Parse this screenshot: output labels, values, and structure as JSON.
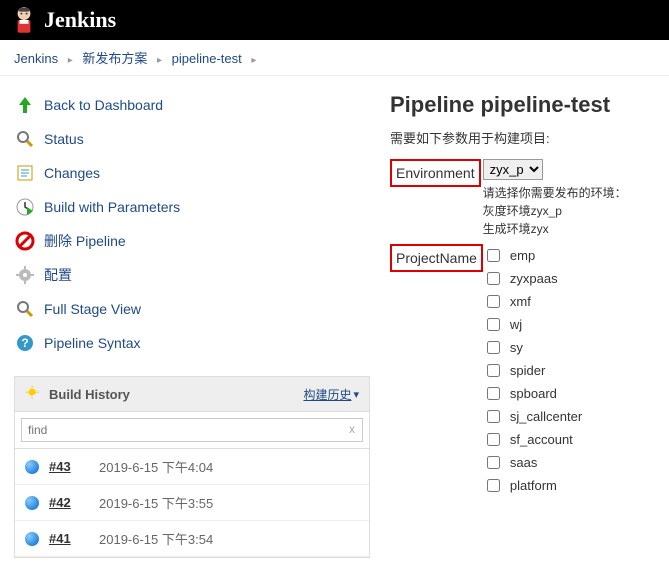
{
  "header": {
    "brand": "Jenkins"
  },
  "breadcrumb": {
    "items": [
      "Jenkins",
      "新发布方案",
      "pipeline-test"
    ]
  },
  "sidebar": {
    "tasks": [
      {
        "label": "Back to Dashboard",
        "icon": "up-arrow-icon"
      },
      {
        "label": "Status",
        "icon": "search-icon"
      },
      {
        "label": "Changes",
        "icon": "notes-icon"
      },
      {
        "label": "Build with Parameters",
        "icon": "clock-play-icon"
      },
      {
        "label": "删除 Pipeline",
        "icon": "delete-icon"
      },
      {
        "label": "配置",
        "icon": "gear-icon"
      },
      {
        "label": "Full Stage View",
        "icon": "search-icon"
      },
      {
        "label": "Pipeline Syntax",
        "icon": "help-icon"
      }
    ]
  },
  "history": {
    "title": "Build History",
    "trend_label": "构建历史",
    "find_placeholder": "find",
    "builds": [
      {
        "number": "#43",
        "time": "2019-6-15 下午4:04"
      },
      {
        "number": "#42",
        "time": "2019-6-15 下午3:55"
      },
      {
        "number": "#41",
        "time": "2019-6-15 下午3:54"
      }
    ]
  },
  "main": {
    "title": "Pipeline pipeline-test",
    "subtitle": "需要如下参数用于构建项目:",
    "env_label": "Environment",
    "env_selected": "zyx_p",
    "env_hint1": "请选择你需要发布的环境：",
    "env_hint2": "灰度环境zyx_p",
    "env_hint3": "生成环境zyx",
    "proj_label": "ProjectName",
    "projects": [
      "emp",
      "zyxpaas",
      "xmf",
      "wj",
      "sy",
      "spider",
      "spboard",
      "sj_callcenter",
      "sf_account",
      "saas",
      "platform"
    ]
  }
}
